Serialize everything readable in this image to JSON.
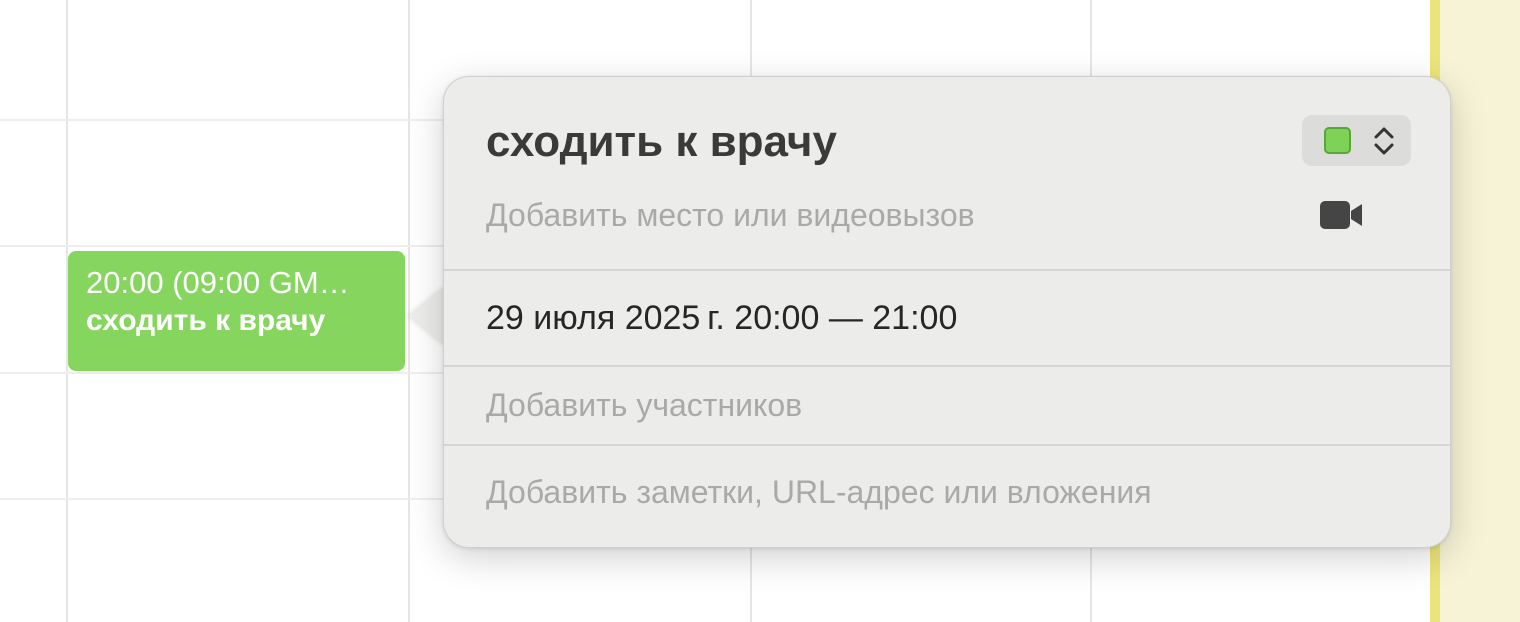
{
  "event": {
    "time_label": "20:00 (09:00 GM…",
    "title": "сходить к врачу",
    "color": "#86d55f"
  },
  "popover": {
    "title": "сходить к врачу",
    "calendar_color": "#7fd258",
    "location_placeholder": "Добавить место или видеовызов",
    "video_icon": "video-camera-icon",
    "datetime": "29 июля 2025 г. 20:00 — 21:00",
    "invitees_placeholder": "Добавить участников",
    "notes_placeholder": "Добавить заметки, URL-адрес или вложения"
  },
  "colors": {
    "today_highlight": "#ece47a",
    "popover_background": "#ececea"
  }
}
